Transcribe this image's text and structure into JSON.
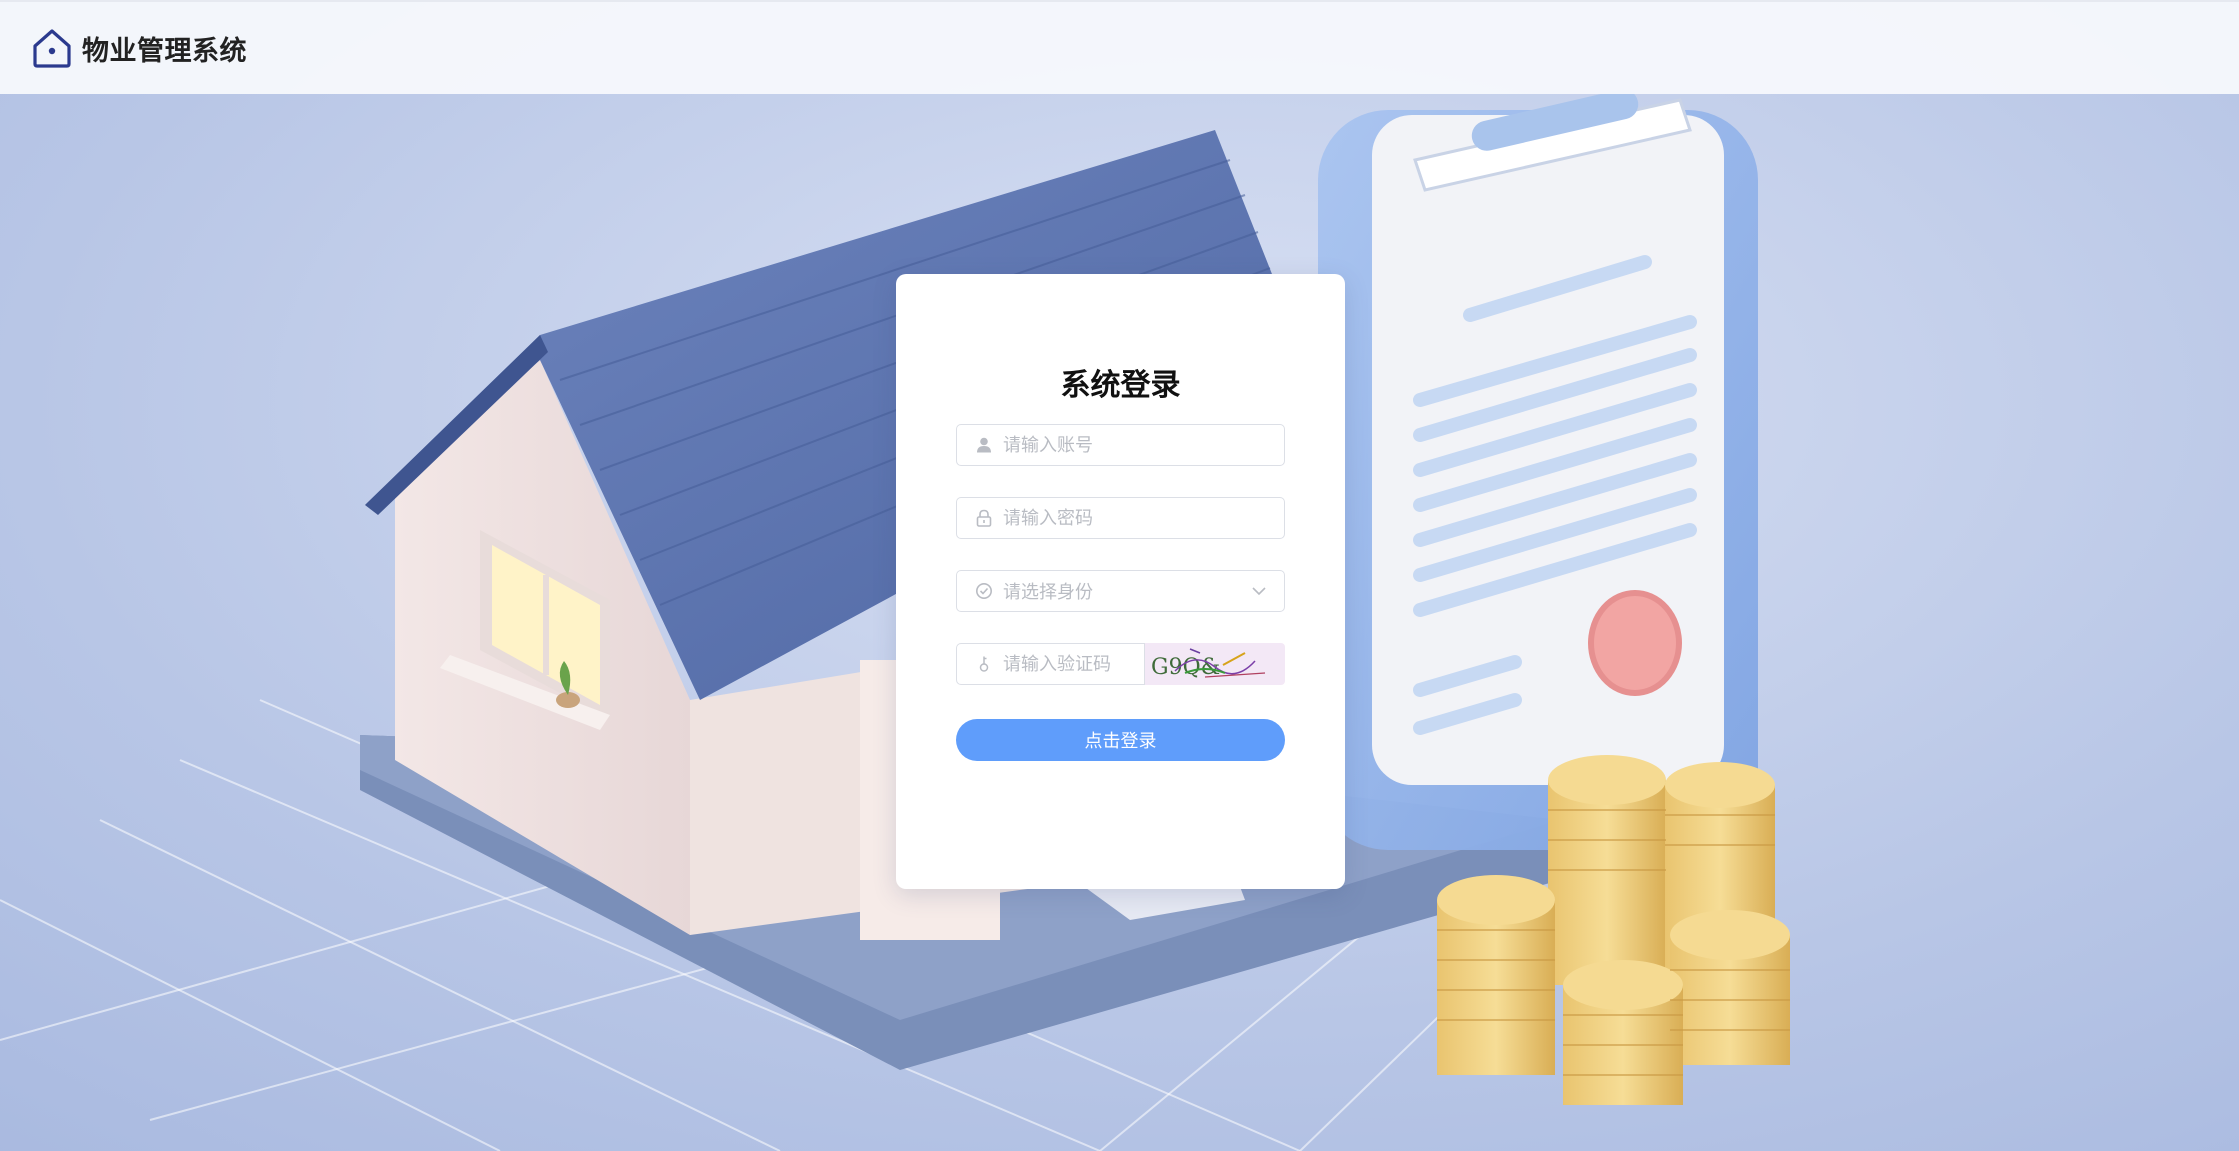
{
  "header": {
    "title": "物业管理系统",
    "logo_icon": "house-icon"
  },
  "login": {
    "title": "系统登录",
    "account": {
      "placeholder": "请输入账号",
      "value": "",
      "icon": "user-icon"
    },
    "password": {
      "placeholder": "请输入密码",
      "value": "",
      "icon": "lock-icon"
    },
    "role": {
      "placeholder": "请选择身份",
      "icon": "check-circle-icon",
      "dropdown_icon": "chevron-down-icon"
    },
    "captcha": {
      "placeholder": "请输入验证码",
      "value": "",
      "icon": "key-icon",
      "image_text": "G9Q&"
    },
    "submit_label": "点击登录"
  },
  "colors": {
    "primary_button": "#5f9dfb",
    "background": "#c9d4ec",
    "card": "#ffffff"
  }
}
